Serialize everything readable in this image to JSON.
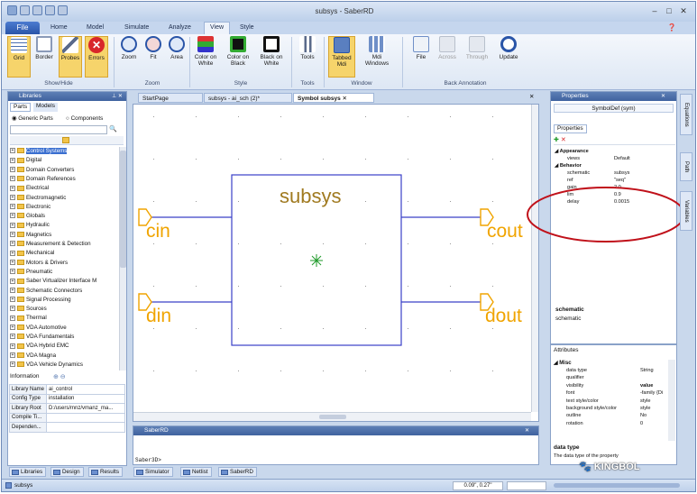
{
  "window": {
    "title": "subsys - SaberRD"
  },
  "ribbon": {
    "tabs": [
      "File",
      "Home",
      "Model",
      "Simulate",
      "Analyze",
      "View",
      "Style"
    ],
    "active_tab": "View",
    "groups": [
      {
        "label": "Show/Hide",
        "buttons": [
          "Grid",
          "Border",
          "Probes",
          "Errors"
        ]
      },
      {
        "label": "Zoom",
        "buttons": [
          "Zoom",
          "Fit",
          "Area"
        ]
      },
      {
        "label": "Style",
        "buttons": [
          "Color on White",
          "Color on Black",
          "Black on White"
        ]
      },
      {
        "label": "Tools",
        "buttons": [
          "Tools"
        ]
      },
      {
        "label": "Window",
        "buttons": [
          "Tabbed Mdi",
          "Mdi Windows"
        ]
      },
      {
        "label": "Back Annotation",
        "buttons": [
          "File",
          "Across",
          "Through",
          "Update"
        ]
      }
    ]
  },
  "libraries": {
    "title": "Libraries",
    "tabs": [
      "Parts",
      "Models"
    ],
    "radio_generic": "Generic Parts",
    "radio_components": "Components",
    "tree": [
      "Control Systems",
      "Digital",
      "Domain Converters",
      "Domain References",
      "Electrical",
      "Electromagnetic",
      "Electronic",
      "Globals",
      "Hydraulic",
      "Magnetics",
      "Measurement & Detection",
      "Mechanical",
      "Motors & Drivers",
      "Pneumatic",
      "Saber Virtualizer Interface M",
      "Schematic Connectors",
      "Signal Processing",
      "Sources",
      "Thermal",
      "VDA Automotive",
      "VDA Fundamentals",
      "VDA Hybrid EMC",
      "VDA Magna",
      "VDA Vehicle Dynamics"
    ],
    "info_title": "Information",
    "info_rows": [
      {
        "key": "Library Name",
        "value": "ai_control"
      },
      {
        "key": "Config Type",
        "value": "installation"
      },
      {
        "key": "Library Root",
        "value": "D:/users/mnz/vmanz_ma..."
      },
      {
        "key": "Compile Ti...",
        "value": ""
      },
      {
        "key": "Dependen...",
        "value": ""
      }
    ]
  },
  "doc_tabs": [
    "StartPage",
    "subsys - ai_sch (2)*",
    "Symbol subsys"
  ],
  "canvas": {
    "block_label": "subsys",
    "ports": [
      "cin",
      "din",
      "cout",
      "dout"
    ]
  },
  "saber": {
    "title": "SaberRD",
    "prompt": "Saber3D>"
  },
  "properties": {
    "title": "Properties",
    "object": "SymbolDef  (sym)",
    "tab": "Properties",
    "sections": [
      {
        "name": "Appearance",
        "rows": [
          {
            "key": "views",
            "value": "Default"
          }
        ]
      },
      {
        "name": "Behavior",
        "rows": [
          {
            "key": "schematic",
            "value": "subsys"
          },
          {
            "key": "ref",
            "value": "\"seq\""
          },
          {
            "key": "gain",
            "value": "2.0"
          },
          {
            "key": "lim",
            "value": "0.9"
          },
          {
            "key": "delay",
            "value": "0.0015"
          }
        ]
      }
    ],
    "desc_title": "schematic",
    "desc_text": "schematic"
  },
  "attributes": {
    "title": "Attributes",
    "section": "Misc",
    "rows": [
      {
        "key": "data type",
        "value": "String"
      },
      {
        "key": "qualifier",
        "value": ""
      },
      {
        "key": "visibility",
        "value": "value"
      },
      {
        "key": "font",
        "value": "-family {Di"
      },
      {
        "key": "text style/color",
        "value": "style"
      },
      {
        "key": "background style/color",
        "value": "style"
      },
      {
        "key": "outline",
        "value": "No"
      },
      {
        "key": "rotation",
        "value": "0"
      }
    ],
    "desc_title": "data type",
    "desc_text": "The data type of the property"
  },
  "side_tabs": [
    "Equations",
    "Path",
    "Variables"
  ],
  "bottom_tabs": [
    "Libraries",
    "Design",
    "Results",
    "Simulator",
    "Netlist",
    "SaberRD"
  ],
  "status": {
    "left": "subsys",
    "coords": "0.09\", 0.27\""
  },
  "watermark": "KINGBOL",
  "colors": {
    "accent": "#f6d46b",
    "port": "#f0a400",
    "wire": "#3a40c8",
    "annotation": "#c0111a"
  }
}
